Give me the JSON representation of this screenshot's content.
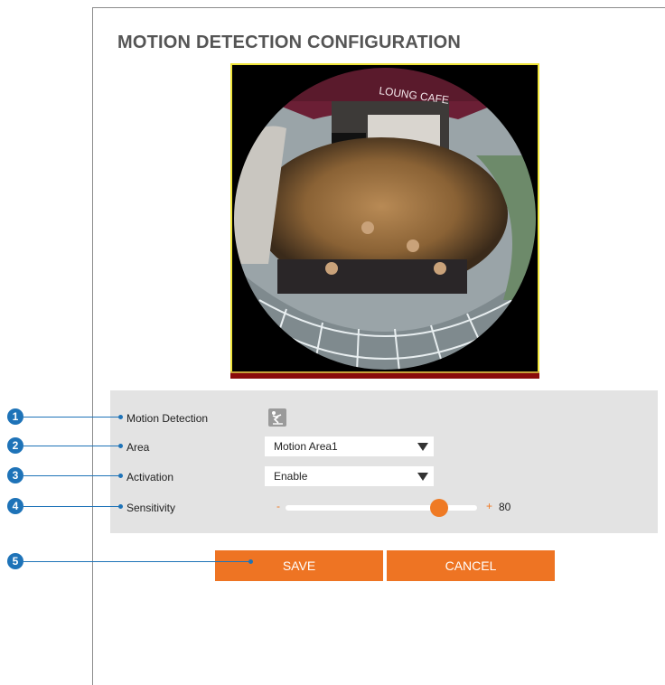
{
  "page": {
    "title": "MOTION DETECTION CONFIGURATION"
  },
  "camera": {
    "overlay_text": "LOUNG CAFE"
  },
  "settings": {
    "motion_detection_label": "Motion Detection",
    "motion_detection_icon": "motion-person-icon",
    "area_label": "Area",
    "area_value": "Motion Area1",
    "activation_label": "Activation",
    "activation_value": "Enable",
    "sensitivity_label": "Sensitivity",
    "sensitivity_minus": "-",
    "sensitivity_plus": "+",
    "sensitivity_value": "80",
    "sensitivity_level": 80
  },
  "buttons": {
    "save_label": "SAVE",
    "cancel_label": "CANCEL"
  },
  "callouts": [
    "1",
    "2",
    "3",
    "4",
    "5"
  ],
  "colors": {
    "accent": "#ee7423",
    "callout": "#1e73b8",
    "panel": "#e3e3e3",
    "camera_border": "#f0e53a"
  }
}
